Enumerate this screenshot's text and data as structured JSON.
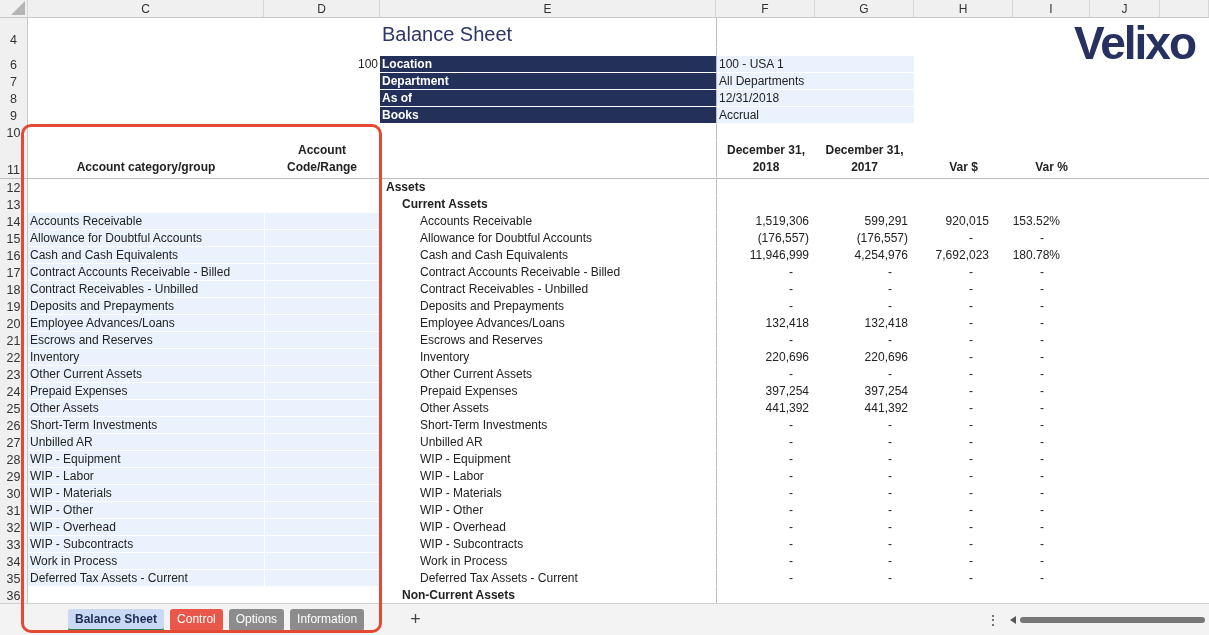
{
  "columns": [
    "C",
    "D",
    "E",
    "F",
    "G",
    "H",
    "I",
    "J"
  ],
  "row_numbers": [
    "4",
    "6",
    "7",
    "8",
    "9",
    "10",
    "11",
    "12",
    "13",
    "14",
    "15",
    "16",
    "17",
    "18",
    "19",
    "20",
    "21",
    "22",
    "23",
    "24",
    "25",
    "26",
    "27",
    "28",
    "29",
    "30",
    "31",
    "32",
    "33",
    "34",
    "35",
    "36"
  ],
  "title": "Balance Sheet",
  "logo": "Velixo",
  "filter_code": "100",
  "filters": [
    {
      "label": "Location",
      "value": "100 - USA 1"
    },
    {
      "label": "Department",
      "value": "All Departments"
    },
    {
      "label": "As of",
      "value": "12/31/2018"
    },
    {
      "label": "Books",
      "value": "Accrual"
    }
  ],
  "headers": {
    "category": "Account category/group",
    "code": "Account Code/Range",
    "period_1": "December 31, 2018",
    "period_2": "December 31, 2017",
    "var_amount": "Var $",
    "var_percent": "Var %"
  },
  "section": "Assets",
  "group": "Current Assets",
  "lines": [
    {
      "category": "Accounts Receivable",
      "name": "Accounts Receivable",
      "values": [
        "1,519,306",
        "599,291",
        "920,015",
        "153.52%"
      ]
    },
    {
      "category": "Allowance for Doubtful Accounts",
      "name": "Allowance for Doubtful Accounts",
      "values": [
        "(176,557)",
        "(176,557)",
        "-",
        "-"
      ]
    },
    {
      "category": "Cash and Cash Equivalents",
      "name": "Cash and Cash Equivalents",
      "values": [
        "11,946,999",
        "4,254,976",
        "7,692,023",
        "180.78%"
      ]
    },
    {
      "category": "Contract Accounts Receivable - Billed",
      "name": "Contract Accounts Receivable - Billed",
      "values": [
        "-",
        "-",
        "-",
        "-"
      ]
    },
    {
      "category": "Contract Receivables - Unbilled",
      "name": "Contract Receivables - Unbilled",
      "values": [
        "-",
        "-",
        "-",
        "-"
      ]
    },
    {
      "category": "Deposits and Prepayments",
      "name": "Deposits and Prepayments",
      "values": [
        "-",
        "-",
        "-",
        "-"
      ]
    },
    {
      "category": "Employee Advances/Loans",
      "name": "Employee Advances/Loans",
      "values": [
        "132,418",
        "132,418",
        "-",
        "-"
      ]
    },
    {
      "category": "Escrows and Reserves",
      "name": "Escrows and Reserves",
      "values": [
        "-",
        "-",
        "-",
        "-"
      ]
    },
    {
      "category": "Inventory",
      "name": "Inventory",
      "values": [
        "220,696",
        "220,696",
        "-",
        "-"
      ]
    },
    {
      "category": "Other Current Assets",
      "name": "Other Current Assets",
      "values": [
        "-",
        "-",
        "-",
        "-"
      ]
    },
    {
      "category": "Prepaid Expenses",
      "name": "Prepaid Expenses",
      "values": [
        "397,254",
        "397,254",
        "-",
        "-"
      ]
    },
    {
      "category": "Other Assets",
      "name": "Other Assets",
      "values": [
        "441,392",
        "441,392",
        "-",
        "-"
      ]
    },
    {
      "category": "Short-Term Investments",
      "name": "Short-Term Investments",
      "values": [
        "-",
        "-",
        "-",
        "-"
      ]
    },
    {
      "category": "Unbilled AR",
      "name": "Unbilled AR",
      "values": [
        "-",
        "-",
        "-",
        "-"
      ]
    },
    {
      "category": "WIP - Equipment",
      "name": "WIP - Equipment",
      "values": [
        "-",
        "-",
        "-",
        "-"
      ]
    },
    {
      "category": "WIP - Labor",
      "name": "WIP - Labor",
      "values": [
        "-",
        "-",
        "-",
        "-"
      ]
    },
    {
      "category": "WIP - Materials",
      "name": "WIP - Materials",
      "values": [
        "-",
        "-",
        "-",
        "-"
      ]
    },
    {
      "category": "WIP - Other",
      "name": "WIP - Other",
      "values": [
        "-",
        "-",
        "-",
        "-"
      ]
    },
    {
      "category": "WIP - Overhead",
      "name": "WIP - Overhead",
      "values": [
        "-",
        "-",
        "-",
        "-"
      ]
    },
    {
      "category": "WIP - Subcontracts",
      "name": "WIP - Subcontracts",
      "values": [
        "-",
        "-",
        "-",
        "-"
      ]
    },
    {
      "category": "Work in Process",
      "name": "Work in Process",
      "values": [
        "-",
        "-",
        "-",
        "-"
      ]
    },
    {
      "category": "Deferred Tax Assets - Current",
      "name": "Deferred Tax Assets - Current",
      "values": [
        "-",
        "-",
        "-",
        "-"
      ]
    }
  ],
  "next_group": "Non-Current Assets",
  "sheet_tabs": [
    {
      "label": "Balance Sheet",
      "selected": true,
      "color": "#c9d8f3"
    },
    {
      "label": "Control",
      "selected": false,
      "color": "#e8574a"
    },
    {
      "label": "Options",
      "selected": false,
      "color": "#8c8c8c"
    },
    {
      "label": "Information",
      "selected": false,
      "color": "#8c8c8c"
    }
  ],
  "add_sheet": "+",
  "more_menu": "⋮"
}
